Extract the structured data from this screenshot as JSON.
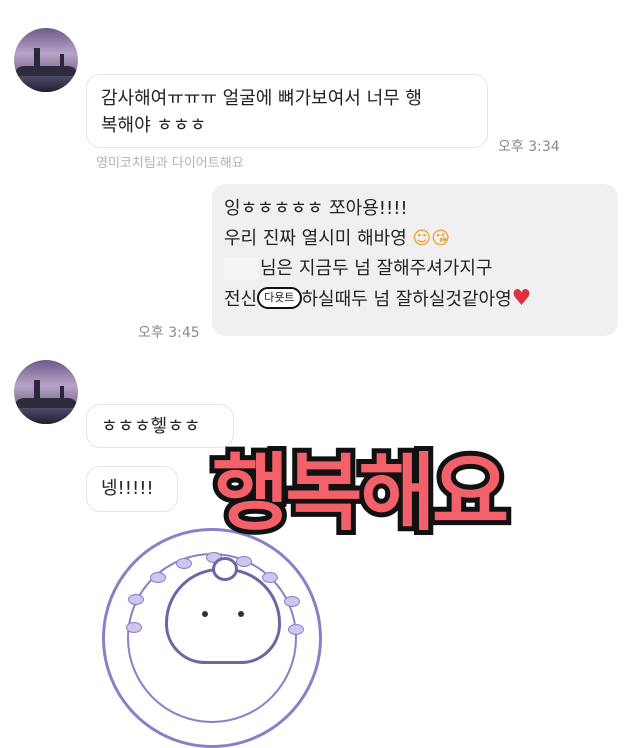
{
  "messages": {
    "m1_line1": "감사해여ㅠㅠㅠ 얼굴에 뼈가보여서 너무 행",
    "m1_line2": "복해야 ㅎㅎㅎ",
    "m1_time": "오후 3:34",
    "m1_sub": "영미코치팀과 다이어트해요",
    "m2_line1": "잉ㅎㅎㅎㅎㅎ 쪼아용!!!!",
    "m2_line2": "우리 진짜 열시미 해바영",
    "m2_line2_emoji": "☺😘",
    "m2_line3": "님은 지금두 넘 잘해주셔가지구",
    "m2_line4_a": "전신",
    "m2_sticker": "다욧트",
    "m2_line4_b": "하실때두 넘 잘하실것같아영",
    "m2_line4_emoji": "♥",
    "m2_time": "오후 3:45",
    "m3": "ㅎㅎㅎ헿ㅎㅎ",
    "m4": "넹!!!!!"
  },
  "overlay": {
    "headline": "행복해요"
  },
  "colors": {
    "headline": "#f2606a",
    "stamp": "#8d7fc7",
    "heart": "#e0303a"
  }
}
